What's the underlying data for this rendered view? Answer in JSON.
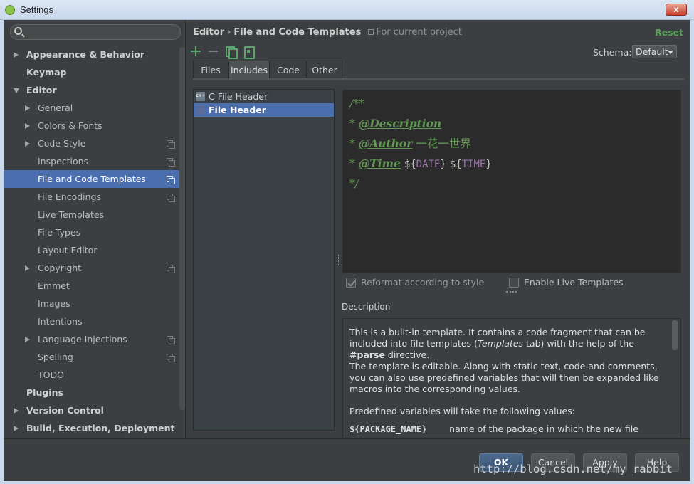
{
  "window": {
    "title": "Settings",
    "close_label": "x"
  },
  "tree": [
    {
      "label": "Appearance & Behavior",
      "level": 0,
      "arrow": "right"
    },
    {
      "label": "Keymap",
      "level": 0,
      "arrow": "none"
    },
    {
      "label": "Editor",
      "level": 0,
      "arrow": "down"
    },
    {
      "label": "General",
      "level": 1,
      "arrow": "right"
    },
    {
      "label": "Colors & Fonts",
      "level": 1,
      "arrow": "right"
    },
    {
      "label": "Code Style",
      "level": 1,
      "arrow": "right",
      "project": true
    },
    {
      "label": "Inspections",
      "level": 1,
      "arrow": "none",
      "project": true
    },
    {
      "label": "File and Code Templates",
      "level": 1,
      "arrow": "none",
      "project": true,
      "selected": true
    },
    {
      "label": "File Encodings",
      "level": 1,
      "arrow": "none",
      "project": true
    },
    {
      "label": "Live Templates",
      "level": 1,
      "arrow": "none"
    },
    {
      "label": "File Types",
      "level": 1,
      "arrow": "none"
    },
    {
      "label": "Layout Editor",
      "level": 1,
      "arrow": "none"
    },
    {
      "label": "Copyright",
      "level": 1,
      "arrow": "right",
      "project": true
    },
    {
      "label": "Emmet",
      "level": 1,
      "arrow": "none"
    },
    {
      "label": "Images",
      "level": 1,
      "arrow": "none"
    },
    {
      "label": "Intentions",
      "level": 1,
      "arrow": "none"
    },
    {
      "label": "Language Injections",
      "level": 1,
      "arrow": "right",
      "project": true
    },
    {
      "label": "Spelling",
      "level": 1,
      "arrow": "none",
      "project": true
    },
    {
      "label": "TODO",
      "level": 1,
      "arrow": "none"
    },
    {
      "label": "Plugins",
      "level": 0,
      "arrow": "none"
    },
    {
      "label": "Version Control",
      "level": 0,
      "arrow": "right"
    },
    {
      "label": "Build, Execution, Deployment",
      "level": 0,
      "arrow": "right"
    }
  ],
  "header": {
    "crumb_1": "Editor",
    "crumb_sep": "›",
    "crumb_2": "File and Code Templates",
    "scope": "For current project",
    "reset": "Reset"
  },
  "schema": {
    "label": "Schema:",
    "value": "Default"
  },
  "tabs": [
    {
      "label": "Files",
      "active": false
    },
    {
      "label": "Includes",
      "active": true
    },
    {
      "label": "Code",
      "active": false
    },
    {
      "label": "Other",
      "active": false
    }
  ],
  "templates": [
    {
      "name": "C File Header",
      "icon": "cpp-file-icon",
      "selected": false
    },
    {
      "name": "File Header",
      "icon": "file-template-icon",
      "selected": true
    }
  ],
  "editor": {
    "line1": "/**",
    "star": "* ",
    "desc_tag": "@Description",
    "author_tag": "@Author",
    "author_value": "一花一世界",
    "time_tag": "@Time",
    "date_open": "${",
    "date_var": "DATE",
    "date_close": "}",
    "time_open": "${",
    "time_var": "TIME",
    "time_close": "}",
    "end": "*/"
  },
  "options": {
    "reformat": "Reformat according to style",
    "live_templates": "Enable Live Templates"
  },
  "description": {
    "label": "Description",
    "p1_a": "This is a built-in template. It contains a code fragment that can be included into file templates (",
    "p1_italic": "Templates",
    "p1_b": " tab) with the help of the ",
    "p1_code": "#parse",
    "p1_c": " directive.",
    "p2": "The template is editable. Along with static text, code and comments, you can also use predefined variables that will then be expanded like macros into the corresponding values.",
    "p3": "Predefined variables will take the following values:",
    "var_name": "${PACKAGE_NAME}",
    "var_desc": "name of the package in which the new file"
  },
  "buttons": {
    "ok": "OK",
    "cancel": "Cancel",
    "apply": "Apply",
    "help": "Help"
  },
  "watermark": "http://blog.csdn.net/my_rabbit"
}
